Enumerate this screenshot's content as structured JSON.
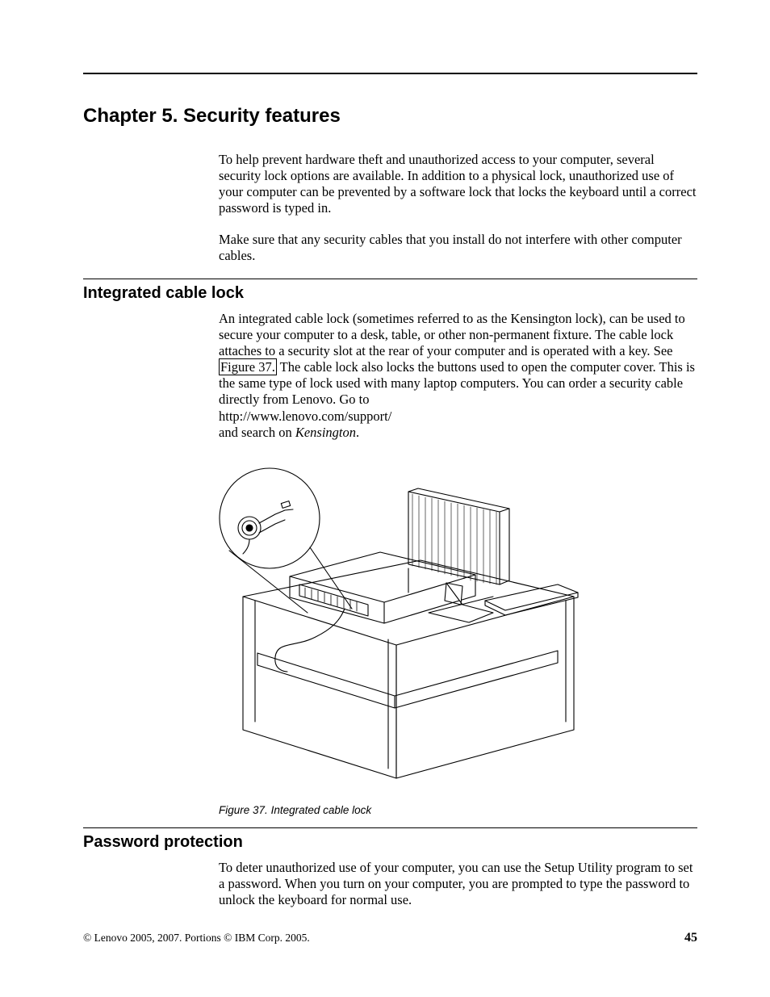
{
  "chapter_title": "Chapter 5. Security features",
  "intro_p1": "To help prevent hardware theft and unauthorized access to your computer, several security lock options are available. In addition to a physical lock, unauthorized use of your computer can be prevented by a software lock that locks the keyboard until a correct password is typed in.",
  "intro_p2": "Make sure that any security cables that you install do not interfere with other computer cables.",
  "section1": {
    "heading": "Integrated cable lock",
    "p_lead": "An integrated cable lock (sometimes referred to as the Kensington lock), can be used to secure your computer to a desk, table, or other non-permanent fixture. The cable lock attaches to a security slot at the rear of your computer and is operated with a key. See ",
    "xref": "Figure 37.",
    "p_tail": " The cable lock also locks the buttons used to open the computer cover. This is the same type of lock used with many laptop computers. You can order a security cable directly from Lenovo. Go to",
    "url": "http://www.lenovo.com/support/",
    "search_lead": "and search on ",
    "search_term": "Kensington",
    "search_period": "."
  },
  "figure": {
    "caption_label": "Figure 37.",
    "caption_text": "Integrated cable lock"
  },
  "section2": {
    "heading": "Password protection",
    "p1": "To deter unauthorized use of your computer, you can use the Setup Utility program to set a password. When you turn on your computer, you are prompted to type the password to unlock the keyboard for normal use."
  },
  "footer": {
    "copyright": "© Lenovo 2005, 2007. Portions © IBM Corp. 2005.",
    "page": "45"
  }
}
